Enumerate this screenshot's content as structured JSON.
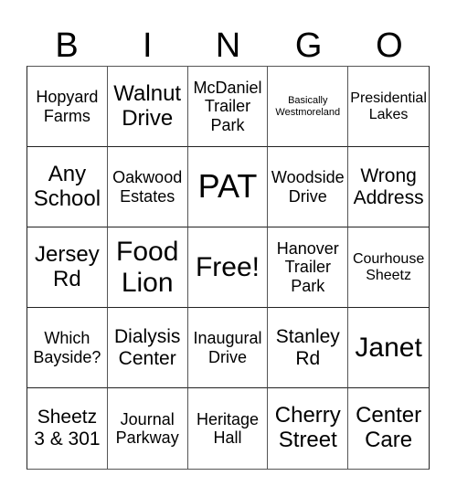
{
  "title_letters": [
    "B",
    "I",
    "N",
    "G",
    "O"
  ],
  "free_space_label": "Free!",
  "cells": [
    {
      "text": "Hopyard Farms",
      "size": "md"
    },
    {
      "text": "Walnut Drive",
      "size": "xl"
    },
    {
      "text": "McDaniel Trailer Park",
      "size": "md"
    },
    {
      "text": "Basically Westmoreland",
      "size": "xs"
    },
    {
      "text": "Presidential Lakes",
      "size": "sm"
    },
    {
      "text": "Any School",
      "size": "xl"
    },
    {
      "text": "Oakwood Estates",
      "size": "md"
    },
    {
      "text": "PAT",
      "size": "huge"
    },
    {
      "text": "Woodside Drive",
      "size": "md"
    },
    {
      "text": "Wrong Address",
      "size": "lg"
    },
    {
      "text": "Jersey Rd",
      "size": "xl"
    },
    {
      "text": "Food Lion",
      "size": "xxl"
    },
    {
      "text": "Free!",
      "size": "xxl",
      "free": true
    },
    {
      "text": "Hanover Trailer Park",
      "size": "md"
    },
    {
      "text": "Courhouse Sheetz",
      "size": "sm"
    },
    {
      "text": "Which Bayside?",
      "size": "md"
    },
    {
      "text": "Dialysis Center",
      "size": "lg"
    },
    {
      "text": "Inaugural Drive",
      "size": "md"
    },
    {
      "text": "Stanley Rd",
      "size": "lg"
    },
    {
      "text": "Janet",
      "size": "xxl"
    },
    {
      "text": "Sheetz 3 & 301",
      "size": "lg"
    },
    {
      "text": "Journal Parkway",
      "size": "md"
    },
    {
      "text": "Heritage Hall",
      "size": "md"
    },
    {
      "text": "Cherry Street",
      "size": "xl"
    },
    {
      "text": "Center Care",
      "size": "xl"
    }
  ]
}
